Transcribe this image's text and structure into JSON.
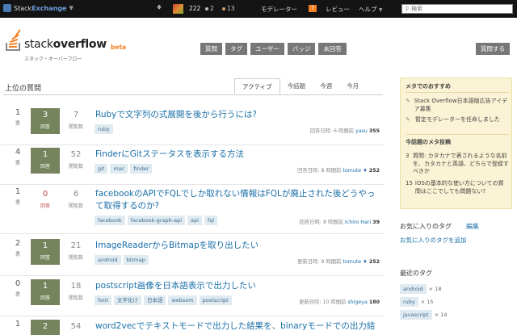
{
  "topbar": {
    "brand_prefix": "Stack",
    "brand_suffix": "Exchange",
    "reputation": "222",
    "silver_badges": "2",
    "bronze_badges": "13",
    "moderator": "モデレーター",
    "moderator_count": "7",
    "review": "レビュー",
    "help": "ヘルプ",
    "search_placeholder": "検索"
  },
  "header": {
    "logo_word_1": "stack",
    "logo_word_2": "overflow",
    "logo_beta": "beta",
    "logo_sub": "スタック・オーバーフロー",
    "nav": [
      "質問",
      "タグ",
      "ユーザー",
      "バッジ",
      "未回答"
    ],
    "ask": "質問する"
  },
  "main": {
    "title": "上位の質問",
    "tabs": [
      "アクティブ",
      "今話題",
      "今週",
      "今月"
    ],
    "votes_label": "票",
    "answers_label": "回答",
    "views_label": "閲覧数",
    "questions": [
      {
        "votes": "1",
        "answers": "3",
        "views": "7",
        "title": "Rubyで文字列の式展開を後から行うには?",
        "tags": [
          "ruby"
        ],
        "action": "回答日時:",
        "when": "6 時間前",
        "user": "yasu",
        "rep": "355",
        "mod": false
      },
      {
        "votes": "4",
        "answers": "1",
        "views": "52",
        "title": "FinderにGitステータスを表示する方法",
        "tags": [
          "git",
          "mac",
          "finder"
        ],
        "action": "回答日時:",
        "when": "8 時間前",
        "user": "tomute",
        "rep": "252",
        "mod": true
      },
      {
        "votes": "1",
        "answers": "0",
        "views": "6",
        "title": "facebookのAPIでFQLでしか取れない情報はFQLが廃止された後どうやって取得するのか?",
        "tags": [
          "facebook",
          "facebook-graph-api",
          "api",
          "fql"
        ],
        "action": "回答日時:",
        "when": "8 時間前",
        "user": "Ichiro Hari",
        "rep": "39",
        "mod": false
      },
      {
        "votes": "2",
        "answers": "1",
        "views": "21",
        "title": "ImageReaderからBitmapを取り出したい",
        "tags": [
          "android",
          "bitmap"
        ],
        "action": "更新日時:",
        "when": "9 時間前",
        "user": "tomute",
        "rep": "252",
        "mod": true
      },
      {
        "votes": "0",
        "answers": "1",
        "views": "18",
        "title": "postscript画像を日本語表示で出力したい",
        "tags": [
          "font",
          "文字化け",
          "日本語",
          "websom",
          "postscript"
        ],
        "action": "更新日時:",
        "when": "10 時間前",
        "user": "shigeya",
        "rep": "180",
        "mod": false
      },
      {
        "votes": "1",
        "answers": "2",
        "views": "54",
        "title": "word2vecでテキストモードで出力した結果を、binaryモードでの出力結",
        "tags": [],
        "action": "",
        "when": "",
        "user": "",
        "rep": "",
        "mod": false
      }
    ]
  },
  "sidebar": {
    "recommend_title": "メタでのおすすめ",
    "recommend_items": [
      "Stack Overflow日本語版広告アイデア募集",
      "暫定モデレーターを任命しました"
    ],
    "hot_title": "今話題のメタ投稿",
    "hot_items": [
      {
        "num": "3",
        "text": "質問: カタカナで表されるような名前を、カタカナと英語、どちらで登録すべきか"
      },
      {
        "num": "15",
        "text": "iOSの基本的な使い方についての質問はここでしても問題ない?"
      }
    ],
    "fav_tags": "お気に入りのタグ",
    "fav_edit": "編集",
    "fav_add": "お気に入りのタグを追加",
    "recent_tags_title": "最近のタグ",
    "recent_tags": [
      {
        "name": "android",
        "count": "× 18"
      },
      {
        "name": "ruby",
        "count": "× 15"
      },
      {
        "name": "javascript",
        "count": "× 14"
      }
    ]
  }
}
